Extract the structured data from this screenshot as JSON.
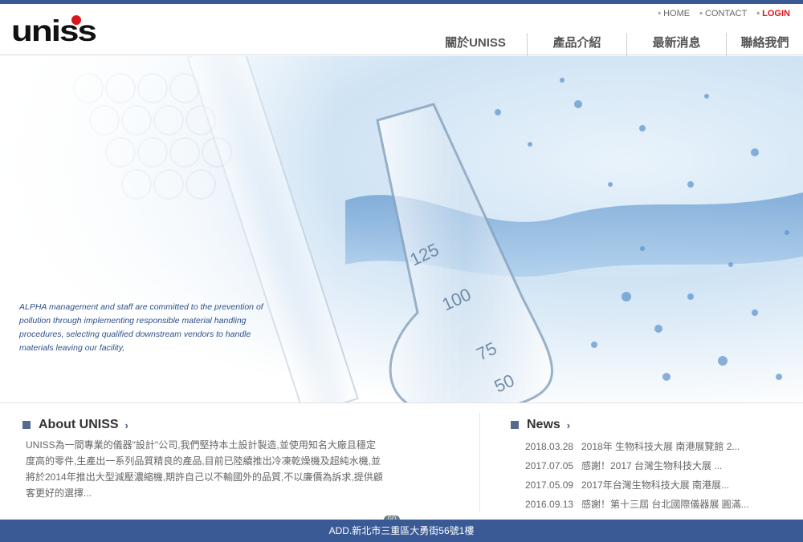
{
  "brand": {
    "logo_text": "uniss"
  },
  "util_nav": [
    {
      "label": "HOME"
    },
    {
      "label": "CONTACT"
    },
    {
      "label": "LOGIN"
    }
  ],
  "main_nav": [
    {
      "label": "關於UNISS"
    },
    {
      "label": "產品介紹"
    },
    {
      "label": "最新消息"
    },
    {
      "label": "聯絡我們"
    }
  ],
  "hero": {
    "caption": "ALPHA management and staff are committed to the prevention of pollution through implementing responsible material handling procedures, selecting qualified downstream vendors to handle materials leaving our facility,",
    "labels": [
      "125",
      "100",
      "75",
      "50"
    ]
  },
  "about": {
    "title": "About UNISS",
    "arrow": "›",
    "text": "UNISS為一間專業的儀器\"設計\"公司,我們堅持本土設計製造,並使用知名大廠且穩定度高的零件,生產出一系列品質精良的產品,目前已陸續推出冷凍乾燥機及超純水機,並將於2014年推出大型減壓濃縮機,期許自己以不輸國外的品質,不以廉價為訴求,提供顧客更好的選擇...",
    "go_label": "GO"
  },
  "news": {
    "title": "News",
    "arrow": "›",
    "items": [
      {
        "date": "2018.03.28",
        "title": "2018年 生物科技大展 南港展覽館 2..."
      },
      {
        "date": "2017.07.05",
        "title": "感謝！2017 台灣生物科技大展 ..."
      },
      {
        "date": "2017.05.09",
        "title": "2017年台灣生物科技大展 南港展..."
      },
      {
        "date": "2016.09.13",
        "title": "感謝！第十三屆 台北國際儀器展 圓滿..."
      }
    ]
  },
  "footer": {
    "address": "ADD.新北市三重區大勇街56號1樓"
  }
}
